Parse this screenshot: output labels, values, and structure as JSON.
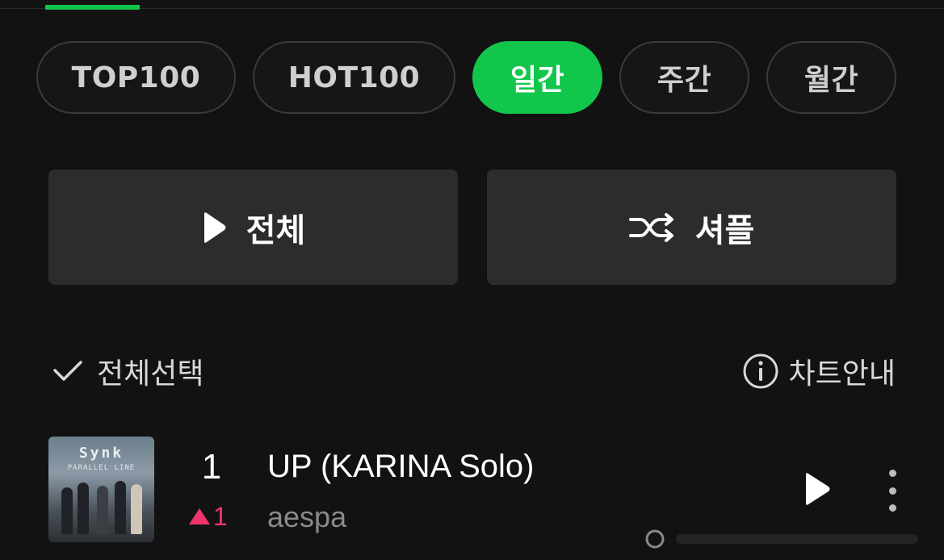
{
  "tabs": [
    {
      "label": "TOP100",
      "active": false
    },
    {
      "label": "HOT100",
      "active": false
    },
    {
      "label": "일간",
      "active": true
    },
    {
      "label": "주간",
      "active": false
    },
    {
      "label": "월간",
      "active": false
    }
  ],
  "actions": {
    "play_all_label": "전체",
    "play_all_icon": "play-icon",
    "shuffle_label": "셔플",
    "shuffle_icon": "shuffle-icon"
  },
  "list_controls": {
    "select_all_label": "전체선택",
    "select_all_icon": "checkmark-icon",
    "chart_info_label": "차트안내",
    "chart_info_icon": "info-icon"
  },
  "songs": [
    {
      "rank": "1",
      "rank_change": "1",
      "rank_change_direction": "up",
      "title": "UP (KARINA Solo)",
      "artist": "aespa",
      "album_art_text": "Synk",
      "album_art_subtext": "PARALLEL LINE"
    }
  ],
  "colors": {
    "accent": "#12c64c",
    "background": "#121212",
    "rank_up": "#f0346c",
    "artist_text": "#8a8a8a"
  }
}
